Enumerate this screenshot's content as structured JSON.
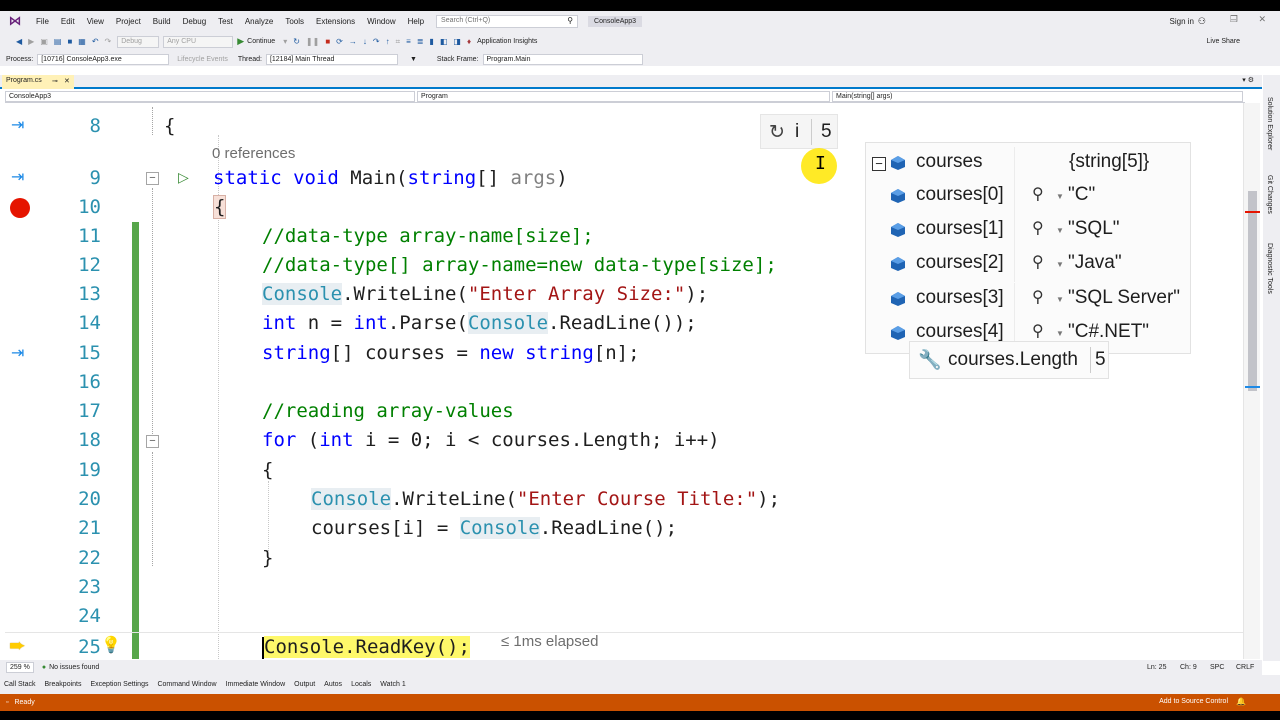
{
  "menubar": {
    "items": [
      "File",
      "Edit",
      "View",
      "Project",
      "Build",
      "Debug",
      "Test",
      "Analyze",
      "Tools",
      "Extensions",
      "Window",
      "Help"
    ],
    "search_placeholder": "Search (Ctrl+Q)",
    "solution_name": "ConsoleApp3",
    "sign_in": "Sign in"
  },
  "toolbar": {
    "config": "Debug",
    "platform": "Any CPU",
    "continue_label": "Continue",
    "app_insights": "Application Insights",
    "live_share": "Live Share"
  },
  "debugbar": {
    "process_label": "Process:",
    "process_value": "[10716] ConsoleApp3.exe",
    "lifecycle_label": "Lifecycle Events",
    "thread_label": "Thread:",
    "thread_value": "[12184] Main Thread",
    "stackframe_label": "Stack Frame:",
    "stackframe_value": "Program.Main"
  },
  "doc_tab": {
    "title": "Program.cs",
    "pin": "⊸",
    "close": "✕"
  },
  "navbar": {
    "project": "ConsoleApp3",
    "type": "Program",
    "member": "Main(string[] args)"
  },
  "side_tabs": [
    "Solution Explorer",
    "Git Changes",
    "Diagnostic Tools"
  ],
  "editor": {
    "references": "0 references",
    "elapsed": "≤ 1ms elapsed",
    "line_numbers": [
      "8",
      "9",
      "10",
      "11",
      "12",
      "13",
      "14",
      "15",
      "16",
      "17",
      "18",
      "19",
      "20",
      "21",
      "22",
      "23",
      "24",
      "25"
    ]
  },
  "datatip_i": {
    "name": "i",
    "value": "5"
  },
  "array_tip": {
    "header_name": "courses",
    "header_value": "{string[5]}",
    "rows": [
      {
        "name": "courses[0]",
        "value": "\"C\""
      },
      {
        "name": "courses[1]",
        "value": "\"SQL\""
      },
      {
        "name": "courses[2]",
        "value": "\"Java\""
      },
      {
        "name": "courses[3]",
        "value": "\"SQL Server\""
      },
      {
        "name": "courses[4]",
        "value": "\"C#.NET\""
      }
    ]
  },
  "length_tip": {
    "name": "courses.Length",
    "value": "5"
  },
  "editor_status": {
    "zoom": "259 %",
    "issues": "No issues found",
    "line": "Ln: 25",
    "col": "Ch: 9",
    "spc": "SPC",
    "eol": "CRLF"
  },
  "tool_tabs": [
    "Call Stack",
    "Breakpoints",
    "Exception Settings",
    "Command Window",
    "Immediate Window",
    "Output",
    "Autos",
    "Locals",
    "Watch 1"
  ],
  "statusbar": {
    "state": "Ready",
    "source_control": "Add to Source Control"
  },
  "colors": {
    "accent": "#007acc",
    "status_debug": "#ca5100",
    "breakpoint": "#e51400",
    "changebar": "#57a64a"
  }
}
